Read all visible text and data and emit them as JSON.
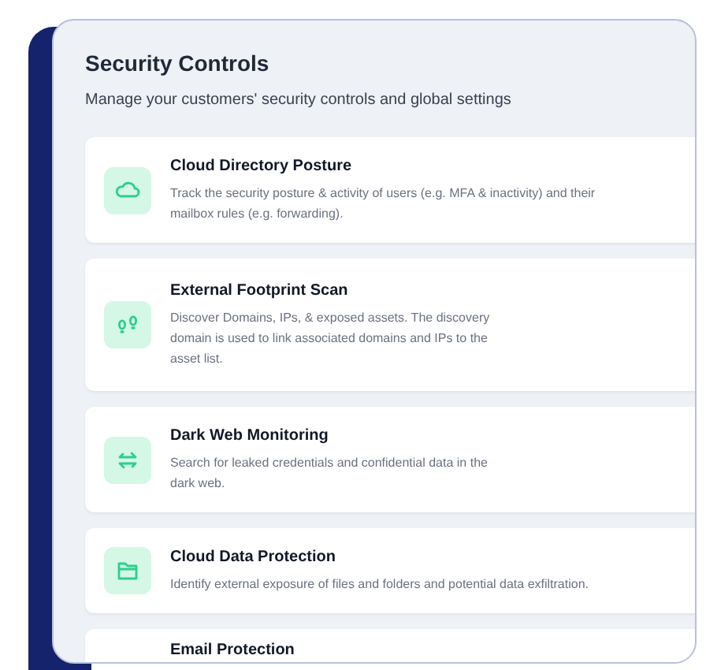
{
  "panel": {
    "title": "Security Controls",
    "subtitle": "Manage your customers' security controls and global settings"
  },
  "controls": [
    {
      "kind": "cloud",
      "title": "Cloud Directory Posture",
      "description": "Track the security posture & activity of users (e.g. MFA & inactivity) and their mailbox rules (e.g. forwarding)."
    },
    {
      "kind": "footprint",
      "title": "External Footprint Scan",
      "description": "Discover Domains, IPs, & exposed assets. The discovery domain is used to link associated domains and IPs to the asset list."
    },
    {
      "kind": "darkweb",
      "title": "Dark Web Monitoring",
      "description": "Search for leaked credentials and confidential data in the dark web."
    },
    {
      "kind": "folder",
      "title": "Cloud Data Protection",
      "description": "Identify external exposure of files and folders and potential data exfiltration."
    },
    {
      "kind": "email",
      "title": "Email Protection"
    }
  ]
}
